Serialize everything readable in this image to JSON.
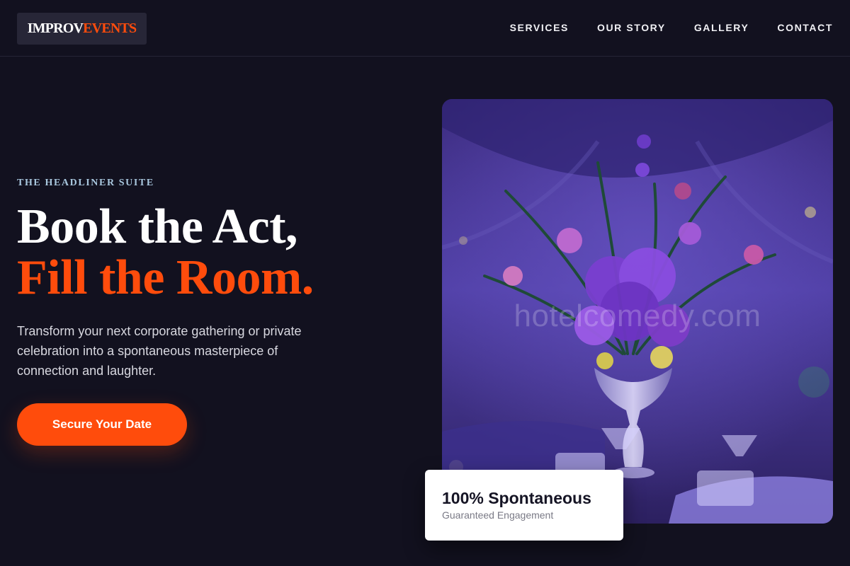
{
  "header": {
    "logo": {
      "word1": "IMPROV",
      "word2": "EVENTS"
    },
    "nav": [
      {
        "label": "SERVICES"
      },
      {
        "label": "OUR STORY"
      },
      {
        "label": "GALLERY"
      },
      {
        "label": "CONTACT"
      }
    ]
  },
  "hero": {
    "eyebrow": "THE HEADLINER SUITE",
    "headline_line1": "Book the Act,",
    "headline_line2": "Fill the Room.",
    "description": "Transform your next corporate gathering or private celebration into a spontaneous masterpiece of connection and laughter.",
    "cta_label": "Secure Your Date",
    "image_watermark": "hotelcomedy.com"
  },
  "stat_card": {
    "title": "100% Spontaneous",
    "subtitle": "Guaranteed Engagement"
  },
  "colors": {
    "background": "#12111f",
    "accent": "#ff4c0c",
    "eyebrow": "#a9c7de",
    "image_purple": "#4e3aa0"
  }
}
